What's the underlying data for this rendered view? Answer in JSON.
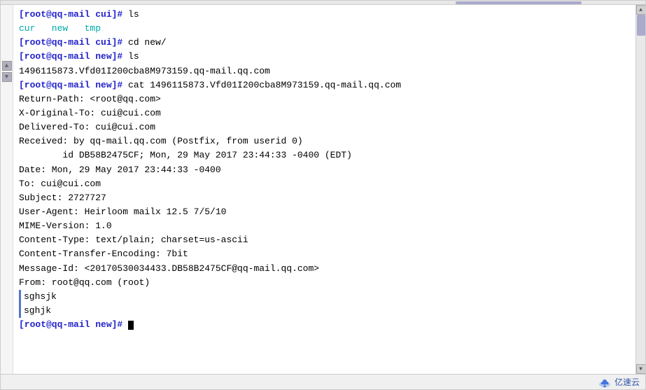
{
  "terminal": {
    "scrollbar_top_label": "",
    "lines": [
      {
        "id": "l1",
        "type": "prompt",
        "text": "[root@qq-mail cui]# ls"
      },
      {
        "id": "l2",
        "type": "cyan",
        "text": "cur   new   tmp"
      },
      {
        "id": "l3",
        "type": "prompt",
        "text": "[root@qq-mail cui]# cd new/"
      },
      {
        "id": "l4",
        "type": "prompt",
        "text": "[root@qq-mail new]# ls"
      },
      {
        "id": "l5",
        "type": "normal",
        "text": "1496115873.Vfd01I200cba8M973159.qq-mail.qq.com"
      },
      {
        "id": "l6",
        "type": "prompt",
        "text": "[root@qq-mail new]# cat 1496115873.Vfd01I200cba8M973159.qq-mail.qq.com"
      },
      {
        "id": "l7",
        "type": "normal",
        "text": "Return-Path: <root@qq.com>"
      },
      {
        "id": "l8",
        "type": "normal",
        "text": "X-Original-To: cui@cui.com"
      },
      {
        "id": "l9",
        "type": "normal",
        "text": "Delivered-To: cui@cui.com"
      },
      {
        "id": "l10",
        "type": "normal",
        "text": "Received: by qq-mail.qq.com (Postfix, from userid 0)"
      },
      {
        "id": "l11",
        "type": "normal",
        "text": "        id DB58B2475CF; Mon, 29 May 2017 23:44:33 -0400 (EDT)"
      },
      {
        "id": "l12",
        "type": "normal",
        "text": "Date: Mon, 29 May 2017 23:44:33 -0400"
      },
      {
        "id": "l13",
        "type": "normal",
        "text": "To: cui@cui.com"
      },
      {
        "id": "l14",
        "type": "normal",
        "text": "Subject: 2727727"
      },
      {
        "id": "l15",
        "type": "normal",
        "text": "User-Agent: Heirloom mailx 12.5 7/5/10"
      },
      {
        "id": "l16",
        "type": "normal",
        "text": "MIME-Version: 1.0"
      },
      {
        "id": "l17",
        "type": "normal",
        "text": "Content-Type: text/plain; charset=us-ascii"
      },
      {
        "id": "l18",
        "type": "normal",
        "text": "Content-Transfer-Encoding: 7bit"
      },
      {
        "id": "l19",
        "type": "normal",
        "text": "Message-Id: <20170530034433.DB58B2475CF@qq-mail.qq.com>"
      },
      {
        "id": "l20",
        "type": "normal",
        "text": "From: root@qq.com (root)"
      },
      {
        "id": "l21",
        "type": "empty",
        "text": ""
      },
      {
        "id": "l22",
        "type": "accent",
        "text": "sghsjk"
      },
      {
        "id": "l23",
        "type": "accent",
        "text": "sghjk"
      },
      {
        "id": "l24",
        "type": "prompt",
        "text": "[root@qq-mail new]# "
      }
    ]
  },
  "brand": {
    "name": "亿速云",
    "icon_label": "cloud-icon"
  }
}
